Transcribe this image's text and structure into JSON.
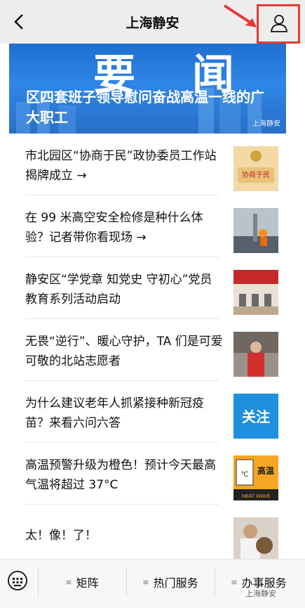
{
  "topbar": {
    "title": "上海静安",
    "back_icon": "chevron-left-icon",
    "profile_icon": "person-icon",
    "highlight_color": "#e53935"
  },
  "banner": {
    "big_text": "要 闻",
    "headline": "区四套班子领导慰问奋战高温一线的广大职工",
    "source": "上海静安"
  },
  "news": [
    {
      "title": "市北园区“协商于民”政协委员工作站揭牌成立 →",
      "thumb_text": "协商于民"
    },
    {
      "title": "在 99 米高空安全检修是种什么体验？记者带你看现场 →"
    },
    {
      "title": "静安区“学党章 知党史 守初心”党员教育系列活动启动"
    },
    {
      "title": "无畏“逆行”、暖心守护，TA 们是可爱可敬的北站志愿者"
    },
    {
      "title": "为什么建议老年人抓紧接种新冠疫苗？来看六问六答",
      "thumb_text": "关注"
    },
    {
      "title": "高温预警升级为橙色！预计今天最高气温将超过 37°C",
      "thumb_text": "高温",
      "thumb_sub": "HEAT WAVE"
    },
    {
      "title": "太！像！了！"
    }
  ],
  "bottombar": {
    "tabs": [
      "矩阵",
      "热门服务",
      "办事服务"
    ],
    "watermark": "上海静安"
  }
}
